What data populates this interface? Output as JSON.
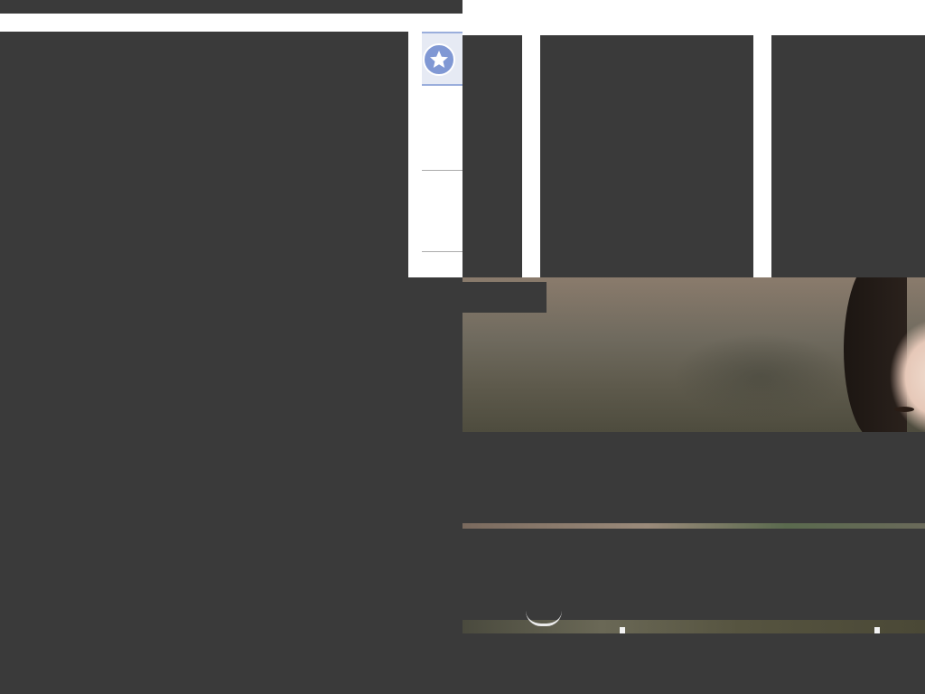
{
  "sidebar": {
    "favorite_icon": "star-icon",
    "accent_color": "#8098d4"
  },
  "colors": {
    "overlay": "#3a3a3a",
    "background": "#ffffff"
  },
  "media": {
    "banner_image": "photo-of-woman-outdoors",
    "strip_image": "photo-strip"
  }
}
